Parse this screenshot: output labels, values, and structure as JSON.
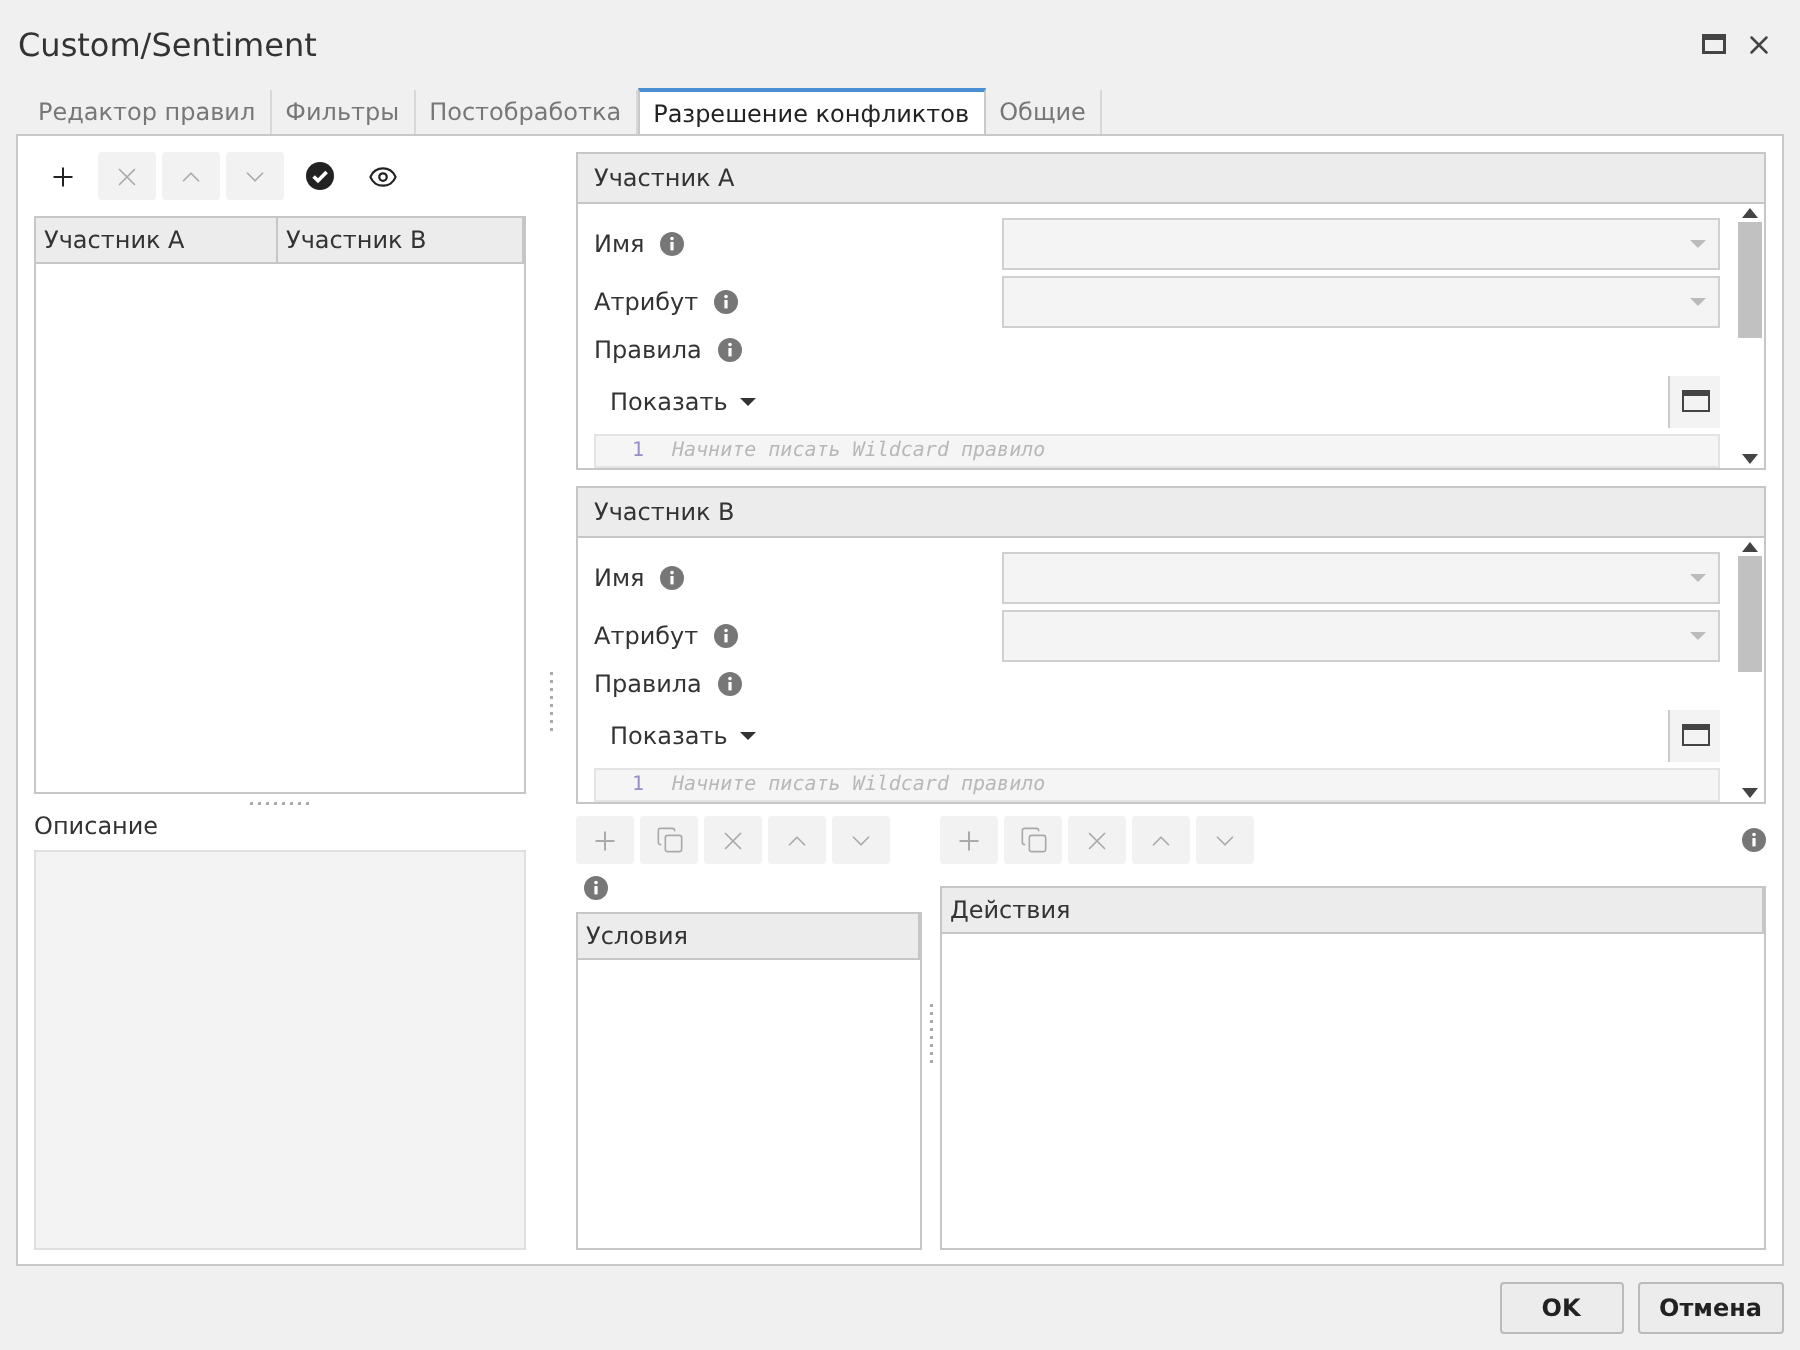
{
  "window": {
    "title": "Custom/Sentiment"
  },
  "tabs": [
    {
      "label": "Редактор правил",
      "selected": false
    },
    {
      "label": "Фильтры",
      "selected": false
    },
    {
      "label": "Постобработка",
      "selected": false
    },
    {
      "label": "Разрешение конфликтов",
      "selected": true
    },
    {
      "label": "Общие",
      "selected": false
    }
  ],
  "left": {
    "toolbar": [
      {
        "kind": "add",
        "disabled": false
      },
      {
        "kind": "delete",
        "disabled": true
      },
      {
        "kind": "up",
        "disabled": true
      },
      {
        "kind": "down",
        "disabled": true
      },
      {
        "kind": "check",
        "disabled": false
      },
      {
        "kind": "view",
        "disabled": false
      }
    ],
    "table": {
      "columns": [
        "Участник A",
        "Участник B"
      ]
    },
    "description": {
      "label": "Описание"
    }
  },
  "participants": [
    {
      "title": "Участник A",
      "fields": [
        {
          "kind": "select",
          "label": "Имя",
          "disabled": true
        },
        {
          "kind": "select",
          "label": "Атрибут",
          "disabled": true
        },
        {
          "kind": "editor",
          "label": "Правила",
          "menu": "Показать",
          "line_number": "1",
          "placeholder": "Начните писать Wildcard правило"
        }
      ]
    },
    {
      "title": "Участник B",
      "fields": [
        {
          "kind": "select",
          "label": "Имя",
          "disabled": true
        },
        {
          "kind": "select",
          "label": "Атрибут",
          "disabled": true
        },
        {
          "kind": "editor",
          "label": "Правила",
          "menu": "Показать",
          "line_number": "1",
          "placeholder": "Начните писать Wildcard правило"
        }
      ]
    }
  ],
  "conditions": {
    "toolbar": [
      {
        "kind": "add",
        "disabled": true
      },
      {
        "kind": "copy",
        "disabled": true
      },
      {
        "kind": "delete",
        "disabled": true
      },
      {
        "kind": "up",
        "disabled": true
      },
      {
        "kind": "down",
        "disabled": true
      }
    ],
    "column": "Условия"
  },
  "actions": {
    "toolbar": [
      {
        "kind": "add",
        "disabled": true
      },
      {
        "kind": "copy",
        "disabled": true
      },
      {
        "kind": "delete",
        "disabled": true
      },
      {
        "kind": "up",
        "disabled": true
      },
      {
        "kind": "down",
        "disabled": true
      }
    ],
    "column": "Действия"
  },
  "buttons": [
    {
      "label": "OK",
      "kind": "primary"
    },
    {
      "label": "Отмена",
      "kind": "secondary"
    }
  ]
}
